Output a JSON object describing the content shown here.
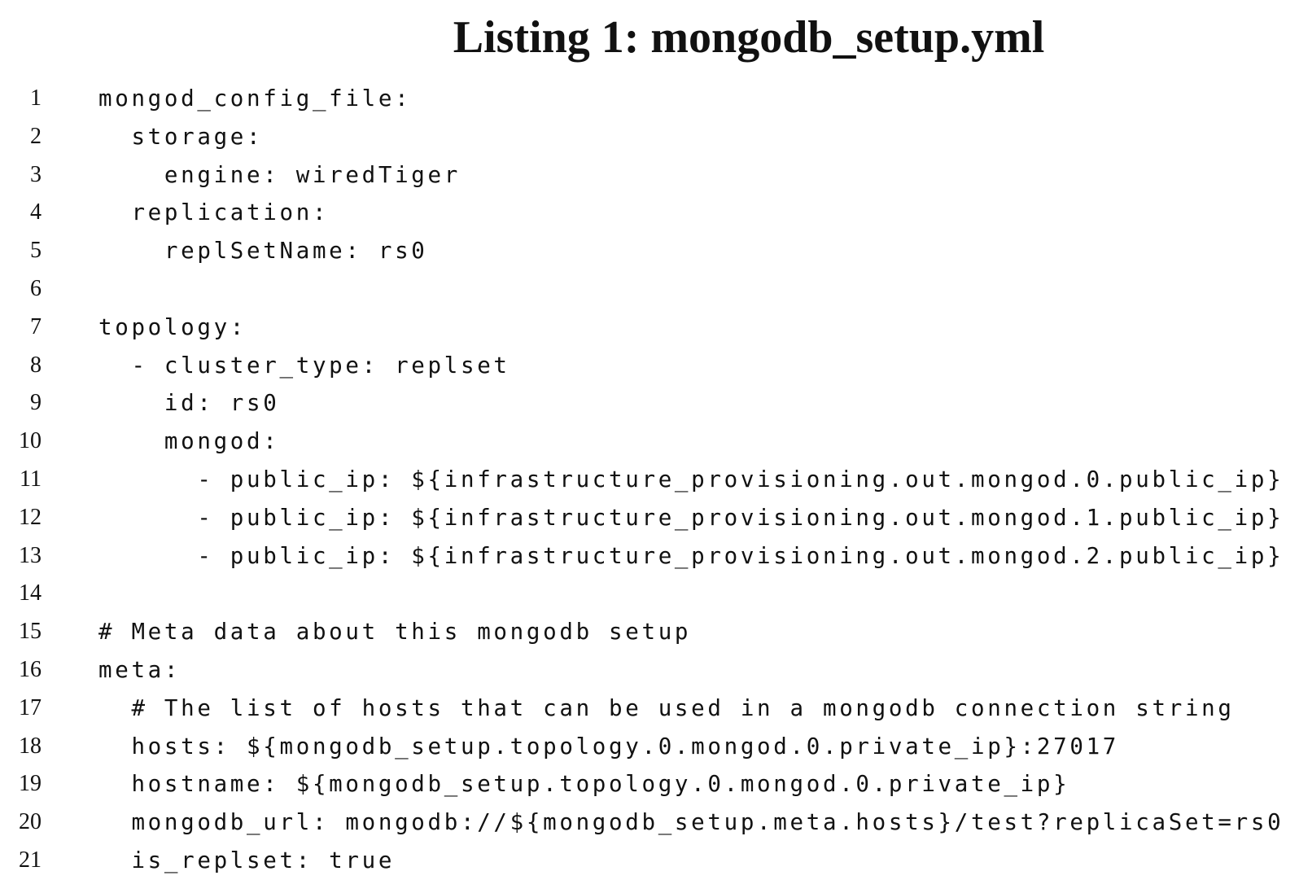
{
  "listing": {
    "title": "Listing 1: mongodb_setup.yml",
    "lines": [
      {
        "number": "1",
        "code": "mongod_config_file:"
      },
      {
        "number": "2",
        "code": "  storage:"
      },
      {
        "number": "3",
        "code": "    engine: wiredTiger"
      },
      {
        "number": "4",
        "code": "  replication:"
      },
      {
        "number": "5",
        "code": "    replSetName: rs0"
      },
      {
        "number": "6",
        "code": ""
      },
      {
        "number": "7",
        "code": "topology:"
      },
      {
        "number": "8",
        "code": "  - cluster_type: replset"
      },
      {
        "number": "9",
        "code": "    id: rs0"
      },
      {
        "number": "10",
        "code": "    mongod:"
      },
      {
        "number": "11",
        "code": "      - public_ip: ${infrastructure_provisioning.out.mongod.0.public_ip}"
      },
      {
        "number": "12",
        "code": "      - public_ip: ${infrastructure_provisioning.out.mongod.1.public_ip}"
      },
      {
        "number": "13",
        "code": "      - public_ip: ${infrastructure_provisioning.out.mongod.2.public_ip}"
      },
      {
        "number": "14",
        "code": ""
      },
      {
        "number": "15",
        "code": "# Meta data about this mongodb setup"
      },
      {
        "number": "16",
        "code": "meta:"
      },
      {
        "number": "17",
        "code": "  # The list of hosts that can be used in a mongodb connection string"
      },
      {
        "number": "18",
        "code": "  hosts: ${mongodb_setup.topology.0.mongod.0.private_ip}:27017"
      },
      {
        "number": "19",
        "code": "  hostname: ${mongodb_setup.topology.0.mongod.0.private_ip}"
      },
      {
        "number": "20",
        "code": "  mongodb_url: mongodb://${mongodb_setup.meta.hosts}/test?replicaSet=rs0"
      },
      {
        "number": "21",
        "code": "  is_replset: true"
      }
    ]
  }
}
